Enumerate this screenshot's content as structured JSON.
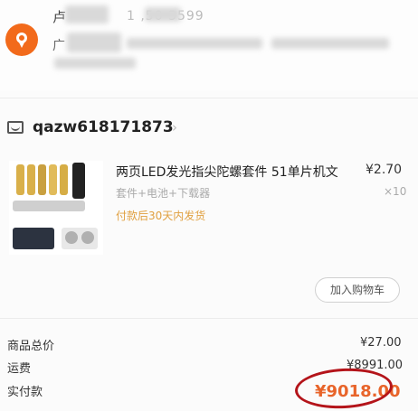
{
  "address": {
    "name_char": "卢",
    "phone_visible": "1 ,50 3599",
    "line_char": "广"
  },
  "shop": {
    "name": "qazw618171873",
    "chevron": "›"
  },
  "product": {
    "title": "两页LED发光指尖陀螺套件 51单片机文",
    "price": "¥2.70",
    "spec": "套件+电池+下载器",
    "qty": "×10",
    "note": "付款后30天内发货",
    "img_labels": [
      "下载器",
      "电池"
    ]
  },
  "cart_button": "加入购物车",
  "summary": {
    "goods_total_label": "商品总价",
    "goods_total_value": "¥27.00",
    "shipping_label": "运费",
    "shipping_value": "¥8991.00",
    "paid_label": "实付款",
    "paid_value": "¥9018.00"
  },
  "colors": {
    "accent": "#f26a1b",
    "paid": "#e8642a",
    "highlight_circle": "#b4141a",
    "note": "#e0a040"
  },
  "icons": [
    "location-pin-icon",
    "shop-icon",
    "chevron-right-icon"
  ]
}
